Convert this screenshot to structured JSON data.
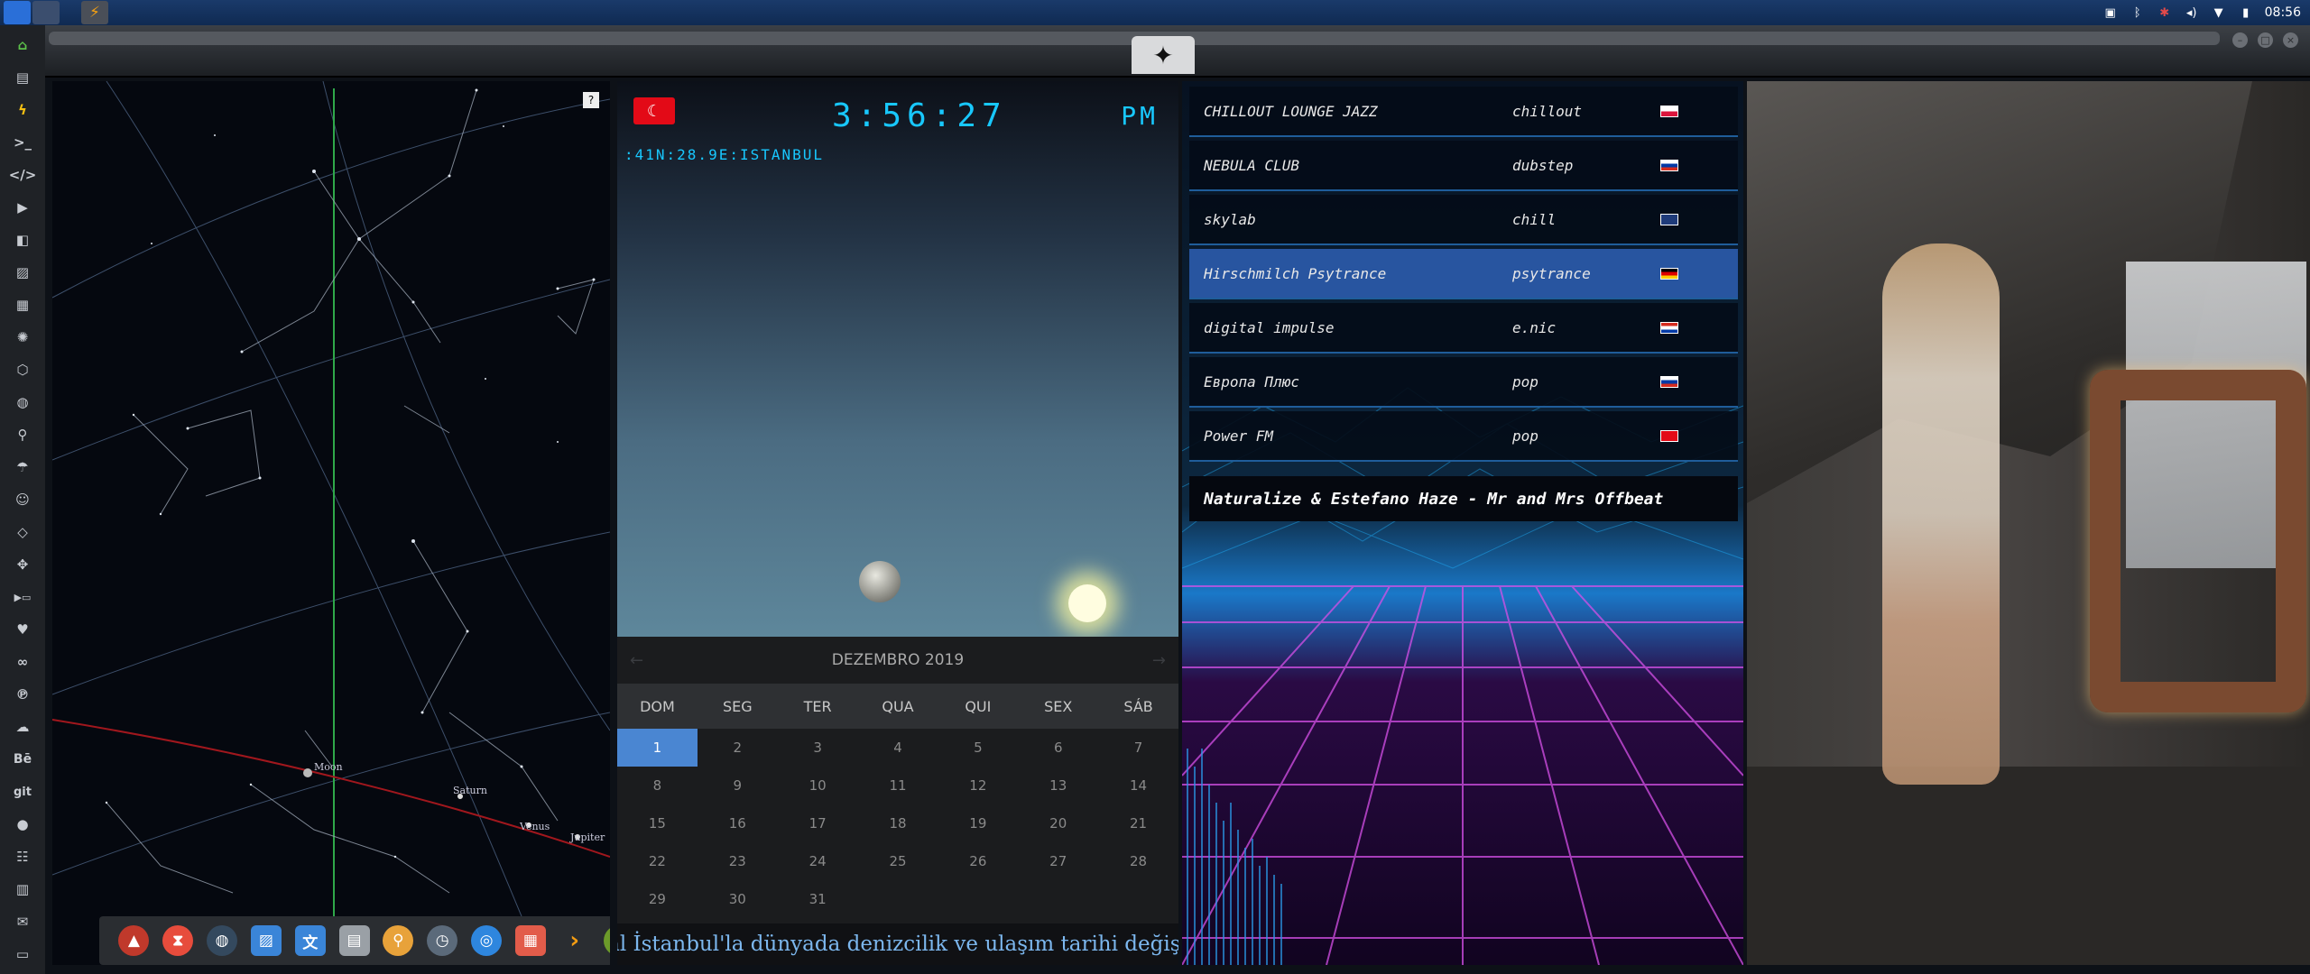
{
  "tray": {
    "time": "08:56"
  },
  "help": "?",
  "sky": {
    "planets": [
      "Moon",
      "Saturn",
      "Venus",
      "Jupiter"
    ]
  },
  "clock": {
    "time": "3:56:27",
    "ampm": "PM",
    "location": ":41N:28.9E:ISTANBUL"
  },
  "calendar": {
    "month": "DEZEMBRO 2019",
    "weekdays": [
      "DOM",
      "SEG",
      "TER",
      "QUA",
      "QUI",
      "SEX",
      "SÁB"
    ],
    "days": [
      "1",
      "2",
      "3",
      "4",
      "5",
      "6",
      "7",
      "8",
      "9",
      "10",
      "11",
      "12",
      "13",
      "14",
      "15",
      "16",
      "17",
      "18",
      "19",
      "20",
      "21",
      "22",
      "23",
      "24",
      "25",
      "26",
      "27",
      "28",
      "29",
      "30",
      "31"
    ],
    "selected": "1"
  },
  "ticker": "\"Kanal İstanbul'la dünyada denizcilik ve ulaşım tarihi değişecek\"",
  "radio": {
    "stations": [
      {
        "name": "CHILLOUT LOUNGE JAZZ",
        "genre": "chillout",
        "flag": "poland"
      },
      {
        "name": "NEBULA CLUB",
        "genre": "dubstep",
        "flag": "russia"
      },
      {
        "name": "skylab",
        "genre": "chill",
        "flag": "uk"
      },
      {
        "name": "Hirschmilch Psytrance",
        "genre": "psytrance",
        "flag": "germany"
      },
      {
        "name": "digital impulse",
        "genre": "e.nic",
        "flag": "croatia"
      },
      {
        "name": "Европа Плюс",
        "genre": "pop",
        "flag": "russia"
      },
      {
        "name": "Power FM",
        "genre": "pop",
        "flag": "turkey"
      }
    ],
    "active_station": "Hirschmilch Psytrance",
    "now_playing": "Naturalize & Estefano Haze - Mr and Mrs Offbeat"
  },
  "photo": {
    "number": "5"
  },
  "colors": {
    "accent": "#18c8ff",
    "calendar_selected": "#4a86d2",
    "active_station": "#2855a0",
    "ticker_text": "#7cb7ee"
  }
}
